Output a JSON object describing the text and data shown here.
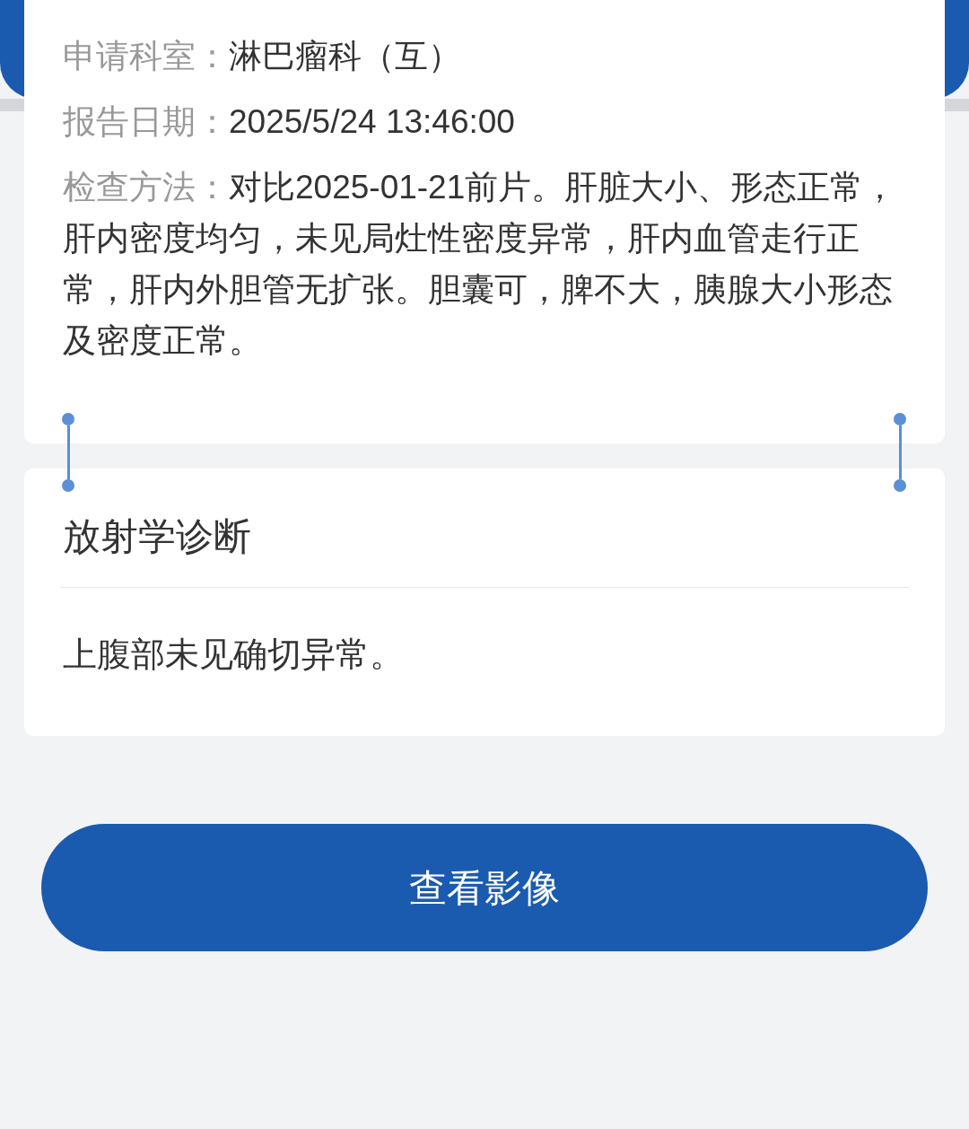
{
  "report_fields": [
    {
      "label": "申请科室：",
      "value": "淋巴瘤科（互）"
    },
    {
      "label": "报告日期：",
      "value": "2025/5/24 13:46:00"
    },
    {
      "label": "检查方法：",
      "value": "对比2025-01-21前片。肝脏大小、形态正常，肝内密度均匀，未见局灶性密度异常，肝内血管走行正常，肝内外胆管无扩张。胆囊可，脾不大，胰腺大小形态及密度正常。"
    }
  ],
  "diagnosis": {
    "title": "放射学诊断",
    "text": "上腹部未见确切异常。"
  },
  "view_images_button": "查看影像"
}
